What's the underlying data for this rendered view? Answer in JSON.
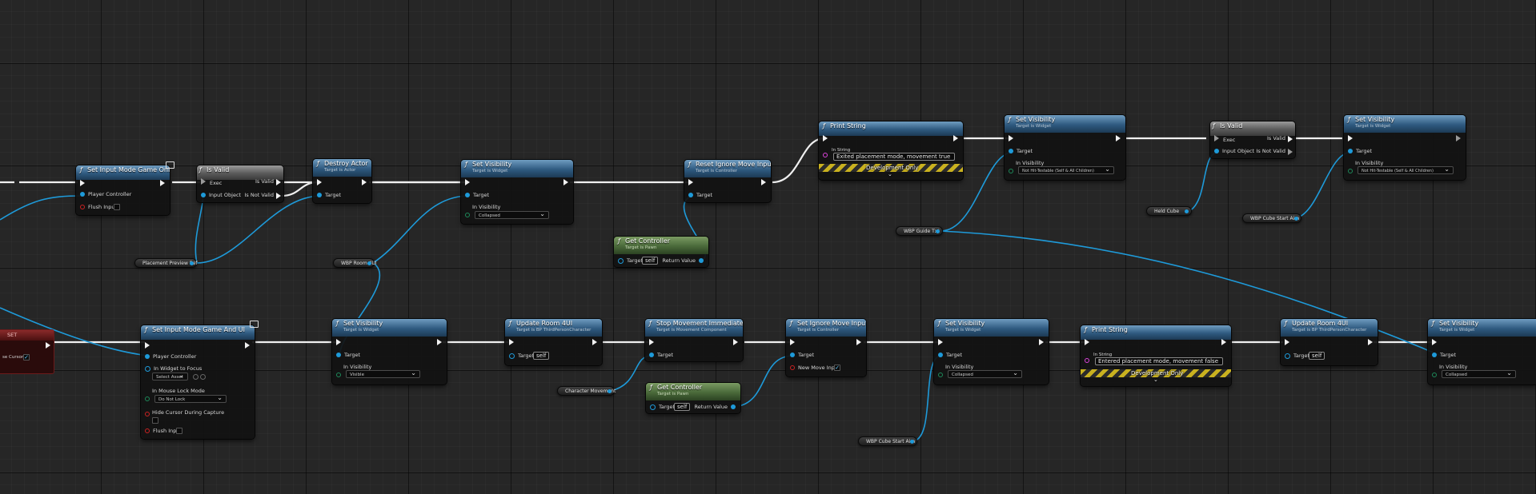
{
  "nodes": {
    "set_input_game_only": {
      "title": "Set Input Mode Game Only",
      "player_controller": "Player Controller",
      "flush_input": "Flush Input"
    },
    "is_valid_1": {
      "title": "Is Valid",
      "exec": "Exec",
      "is_valid": "Is Valid",
      "input_object": "Input Object",
      "is_not_valid": "Is Not Valid"
    },
    "destroy_actor": {
      "title": "Destroy Actor",
      "subtitle": "Target is Actor",
      "target": "Target"
    },
    "set_visibility_1": {
      "title": "Set Visibility",
      "subtitle": "Target is Widget",
      "target": "Target",
      "in_visibility": "In Visibility",
      "visibility_value": "Collapsed"
    },
    "reset_ignore_move": {
      "title": "Reset Ignore Move Input",
      "subtitle": "Target is Controller",
      "target": "Target"
    },
    "get_controller_1": {
      "title": "Get Controller",
      "subtitle": "Target is Pawn",
      "target": "Target",
      "self": "self",
      "return_value": "Return Value"
    },
    "print_string_1": {
      "title": "Print String",
      "in_string_label": "In String",
      "in_string_value": "Exited placement mode, movement true",
      "dev_only": "Development Only"
    },
    "set_visibility_2": {
      "title": "Set Visibility",
      "subtitle": "Target is Widget",
      "target": "Target",
      "in_visibility": "In Visibility",
      "visibility_value": "Not Hit-Testable (Self & All Children)"
    },
    "is_valid_2": {
      "title": "Is Valid",
      "exec": "Exec",
      "is_valid": "Is Valid",
      "input_object": "Input Object",
      "is_not_valid": "Is Not Valid"
    },
    "set_visibility_3": {
      "title": "Set Visibility",
      "subtitle": "Target is Widget",
      "target": "Target",
      "in_visibility": "In Visibility",
      "visibility_value": "Not Hit-Testable (Self & All Children)"
    },
    "set_node": {
      "title": "SET",
      "mouse_cursor": "se Cursor"
    },
    "set_input_game_ui": {
      "title": "Set Input Mode Game And UI",
      "player_controller": "Player Controller",
      "in_widget_to_focus": "In Widget to Focus",
      "select_asset": "Select Asset",
      "mouse_lock_mode": "In Mouse Lock Mode",
      "mouse_lock_value": "Do Not Lock",
      "hide_cursor": "Hide Cursor During Capture",
      "flush_input": "Flush Input"
    },
    "set_visibility_4": {
      "title": "Set Visibility",
      "subtitle": "Target is Widget",
      "target": "Target",
      "in_visibility": "In Visibility",
      "visibility_value": "Visible"
    },
    "update_room_1": {
      "title": "Update Room 4UI",
      "subtitle": "Target is BP ThirdPersonCharacter",
      "target": "Target",
      "self": "self"
    },
    "stop_movement": {
      "title": "Stop Movement Immediately",
      "subtitle": "Target is Movement Component",
      "target": "Target"
    },
    "get_controller_2": {
      "title": "Get Controller",
      "subtitle": "Target is Pawn",
      "target": "Target",
      "self": "self",
      "return_value": "Return Value"
    },
    "set_ignore_move": {
      "title": "Set Ignore Move Input",
      "subtitle": "Target is Controller",
      "target": "Target",
      "new_move_input": "New Move Input"
    },
    "set_visibility_5": {
      "title": "Set Visibility",
      "subtitle": "Target is Widget",
      "target": "Target",
      "in_visibility": "In Visibility",
      "visibility_value": "Collapsed"
    },
    "print_string_2": {
      "title": "Print String",
      "in_string_label": "In String",
      "in_string_value": "Entered placement mode, movement false",
      "dev_only": "Development Only"
    },
    "update_room_2": {
      "title": "Update Room 4UI",
      "subtitle": "Target is BP ThirdPersonCharacter",
      "target": "Target",
      "self": "self"
    },
    "set_visibility_6": {
      "title": "Set Visibility",
      "subtitle": "Target is Widget",
      "target": "Target",
      "in_visibility": "In Visibility",
      "visibility_value": "Collapsed"
    }
  },
  "variables": {
    "placement_preview_ref": "Placement Preview Ref",
    "wbp_room_4ui": "WBP Room 4UI",
    "wbp_guide_txt": "WBP Guide Txt",
    "held_cube": "Held Cube",
    "wbp_cube_start_aim_1": "WBP Cube Start Aim",
    "character_movement": "Character Movement",
    "wbp_cube_start_aim_2": "WBP Cube Start Aim"
  },
  "colors": {
    "exec_wire": "#f0f0f0",
    "object_wire": "#1e9ad9",
    "function_header": "#2f5a80",
    "pure_header": "#4a6a3a",
    "macro_header": "#5a5a5a",
    "dev_stripe": "#c9b11f",
    "background": "#262626"
  }
}
